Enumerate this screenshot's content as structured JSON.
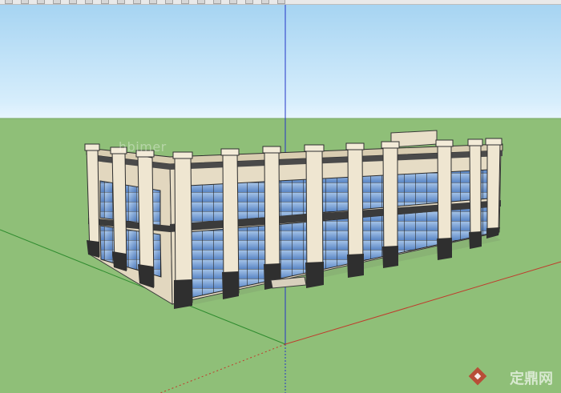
{
  "toolbar": {
    "buttons": [
      "select-tool",
      "eraser-tool",
      "paint-tool",
      "line-tool",
      "rectangle-tool",
      "circle-tool",
      "push-pull-tool",
      "move-tool",
      "rotate-tool",
      "scale-tool",
      "offset-tool",
      "tape-tool",
      "dimension-tool",
      "text-tool",
      "orbit-tool",
      "pan-tool",
      "zoom-tool",
      "zoom-extents-tool"
    ]
  },
  "viewport": {
    "sky_color": "#a6d4f2",
    "horizon_color": "#eaf6ff",
    "ground_color": "#8fbf78",
    "axis_colors": {
      "blue": "#2436c7",
      "red": "#c03a2b",
      "green": "#2e8b2e"
    }
  },
  "watermarks": {
    "top_logo": "hbimer",
    "bottom_brand": "定鼎网",
    "bottom_logo_color": "#c03a2b"
  }
}
